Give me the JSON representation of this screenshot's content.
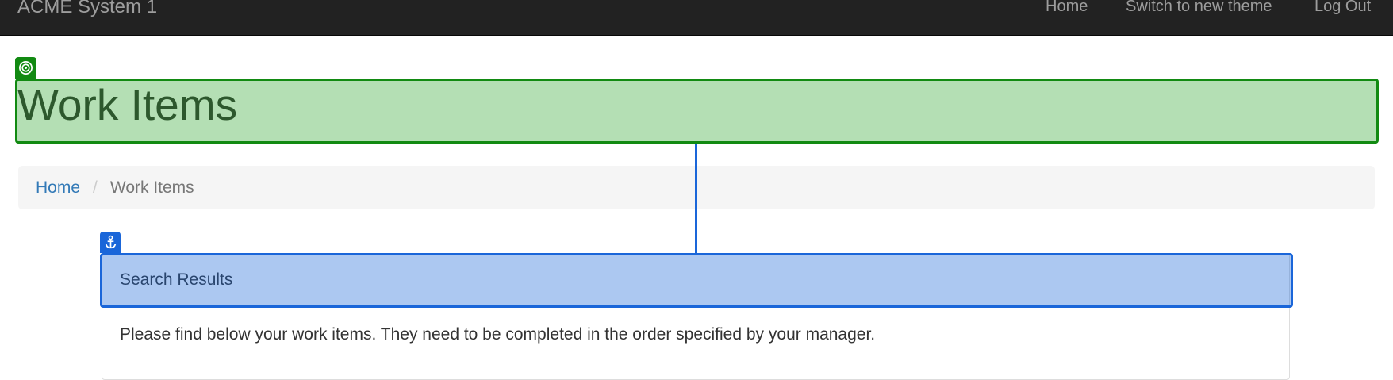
{
  "navbar": {
    "brand": "ACME System 1",
    "links": [
      "Home",
      "Switch to new theme",
      "Log Out"
    ]
  },
  "page": {
    "title": "Work Items"
  },
  "breadcrumb": {
    "home": "Home",
    "separator": "/",
    "current": "Work Items"
  },
  "panel": {
    "heading": "Search Results",
    "body": "Please find below your work items. They need to be completed in the order specified by your manager."
  },
  "overlay": {
    "target_icon": "target-icon",
    "anchor_icon": "anchor-icon",
    "target_color": "#128a12",
    "anchor_color": "#1a66d9"
  }
}
